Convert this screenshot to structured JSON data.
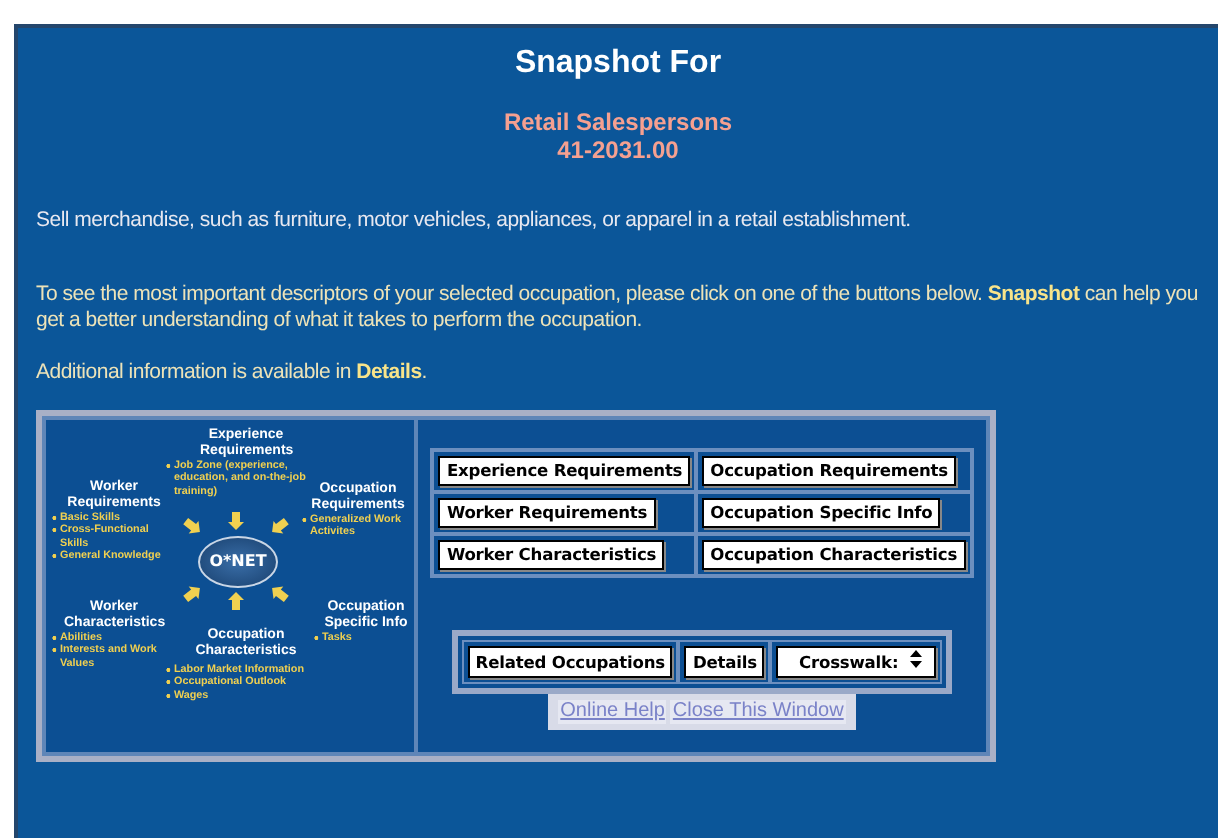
{
  "heading": "Snapshot For",
  "occupation": {
    "title": "Retail Salespersons",
    "code": "41-2031.00"
  },
  "description": "Sell merchandise, such as furniture, motor vehicles, appliances, or apparel in a retail establishment.",
  "intro": "To see the most important descriptors of your selected occupation, please click on one of the buttons below. **Snapshot** can help you get a better understanding of what it takes to perform the occupation.",
  "additional": "Additional information is available in **Details**.",
  "diagram": {
    "logo": "O*NET",
    "groups": [
      {
        "title": "Experience Requirements",
        "items": [
          "Job Zone (experience, education, and on-the-job training)"
        ]
      },
      {
        "title": "Worker Requirements",
        "items": [
          "Basic Skills",
          "Cross-Functional Skills",
          "General Knowledge"
        ]
      },
      {
        "title": "Occupation Requirements",
        "items": [
          "Generalized Work Activites"
        ]
      },
      {
        "title": "Worker Characteristics",
        "items": [
          "Abilities",
          "Interests and Work Values"
        ]
      },
      {
        "title": "Occupation Characteristics",
        "items": [
          "Labor Market Information",
          "Occupational Outlook",
          "Wages"
        ]
      },
      {
        "title": "Occupation Specific Info",
        "items": [
          "Tasks"
        ]
      }
    ]
  },
  "section_buttons": [
    [
      "Experience Requirements",
      "Occupation Requirements"
    ],
    [
      "Worker Requirements",
      "Occupation Specific Info"
    ],
    [
      "Worker Characteristics",
      "Occupation Characteristics"
    ]
  ],
  "bottom_buttons": [
    {
      "kind": "button",
      "label": "Related Occupations"
    },
    {
      "kind": "button",
      "label": "Details"
    },
    {
      "kind": "select",
      "label": "Crosswalk:"
    }
  ],
  "links": [
    "Online Help",
    "Close This Window"
  ]
}
